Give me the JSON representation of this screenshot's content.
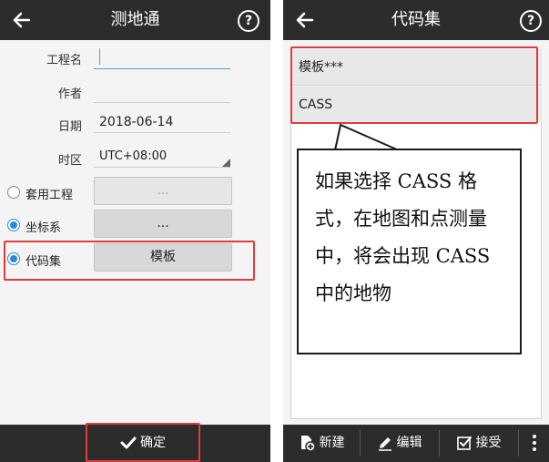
{
  "left": {
    "title": "测地通",
    "form": {
      "project_name_label": "工程名",
      "project_name_value": "",
      "author_label": "作者",
      "author_value": "",
      "date_label": "日期",
      "date_value": "2018-06-14",
      "timezone_label": "时区",
      "timezone_value": "UTC+08:00"
    },
    "options": [
      {
        "label": "套用工程",
        "selected": false,
        "button": "...",
        "enabled": false
      },
      {
        "label": "坐标系",
        "selected": true,
        "button": "...",
        "enabled": true
      },
      {
        "label": "代码集",
        "selected": true,
        "button": "模板",
        "enabled": true
      }
    ],
    "confirm_label": "确定"
  },
  "right": {
    "title": "代码集",
    "items": [
      "模板***",
      "CASS"
    ],
    "note_text": "如果选择 CASS 格式，在地图和点测量中，将会出现 CASS 中的地物",
    "toolbar": {
      "new_label": "新建",
      "edit_label": "编辑",
      "accept_label": "接受"
    }
  },
  "colors": {
    "bar_bg": "#2c2c2c",
    "highlight_red": "#e23b3b",
    "radio_blue": "#2a8ad8"
  }
}
